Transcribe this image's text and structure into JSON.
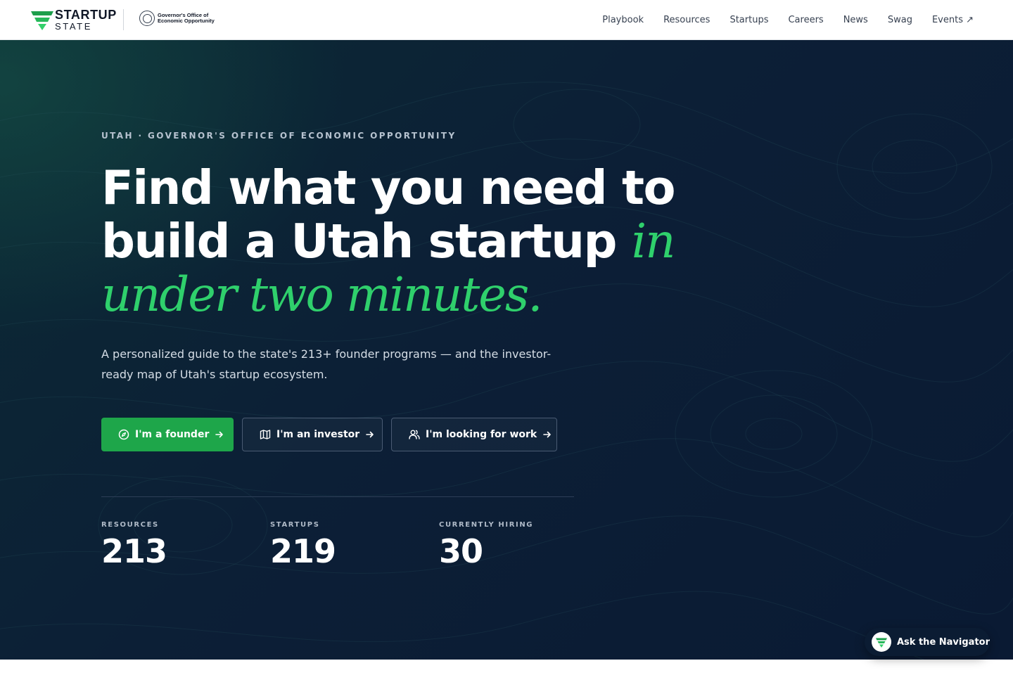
{
  "header": {
    "logo": {
      "line1": "STARTUP",
      "line2": "STATE",
      "icon": "startup-state-logo-icon"
    },
    "partner": {
      "line1": "Governor's Office of",
      "line2": "Economic Opportunity",
      "icon": "state-seal-icon"
    },
    "nav": [
      {
        "label": "Playbook"
      },
      {
        "label": "Resources"
      },
      {
        "label": "Startups"
      },
      {
        "label": "Careers"
      },
      {
        "label": "News"
      },
      {
        "label": "Swag"
      },
      {
        "label": "Events ↗"
      }
    ]
  },
  "hero": {
    "eyebrow": "UTAH · GOVERNOR'S OFFICE OF ECONOMIC OPPORTUNITY",
    "headline": {
      "plain": "Find what you need to build a Utah startup",
      "accent": "in under two minutes."
    },
    "subhead": "A personalized guide to the state's 213+ founder programs — and the investor-ready map of Utah's startup ecosystem.",
    "buttons": [
      {
        "label": "I'm a founder",
        "icon": "compass-icon"
      },
      {
        "label": "I'm an investor",
        "icon": "map-icon"
      },
      {
        "label": "I'm looking for work",
        "icon": "users-icon"
      }
    ],
    "stats": [
      {
        "label": "RESOURCES",
        "value": "213"
      },
      {
        "label": "STARTUPS",
        "value": "219"
      },
      {
        "label": "CURRENTLY HIRING",
        "value": "30"
      }
    ]
  },
  "navigator": {
    "label": "Ask the Navigator",
    "icon": "startup-state-logo-icon"
  },
  "colors": {
    "accent_green": "#2fd06c",
    "button_green": "#1ea64a",
    "hero_navy": "#0c1f36",
    "text_white": "#ffffff"
  }
}
